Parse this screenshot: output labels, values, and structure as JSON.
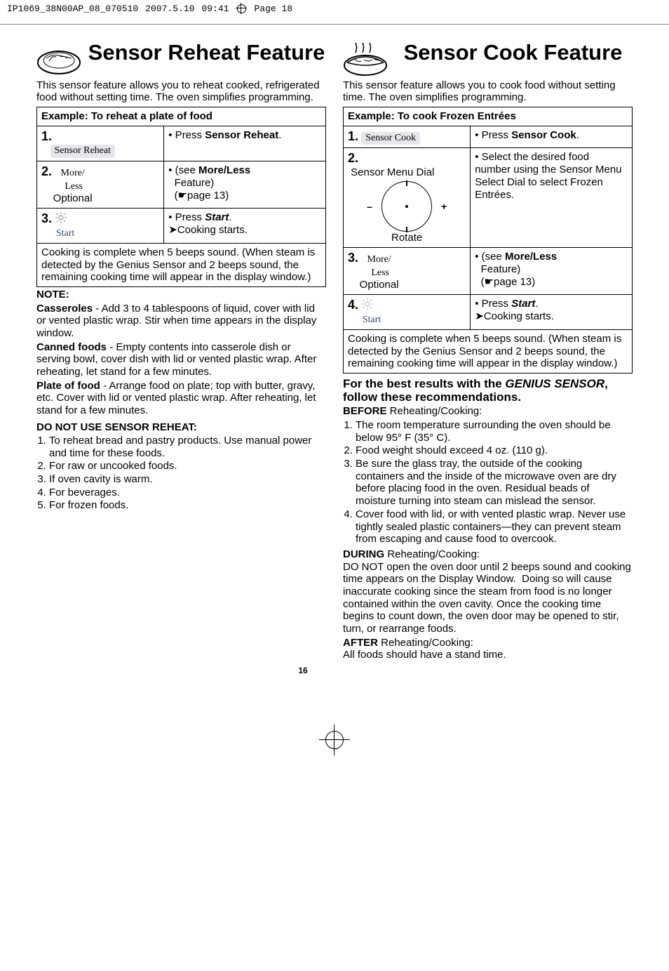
{
  "topbar": {
    "job": "IP1069_38N00AP_08_070510",
    "date": "2007.5.10",
    "time": "09:41",
    "page": "Page 18"
  },
  "left": {
    "title": "Sensor Reheat Feature",
    "intro": "This sensor feature allows you to reheat cooked, refrigerated food without setting time. The oven simplifies programming.",
    "exampleTitle": "Example: To reheat a plate of food",
    "step1": {
      "n": "1.",
      "btn": "Sensor Reheat",
      "r": "• Press Sensor Reheat."
    },
    "step2": {
      "n": "2.",
      "more": "More/",
      "less": "Less",
      "opt": "Optional",
      "r1": "• (see More/Less",
      "r2": "   Feature)",
      "r3": "   (☛page 13)"
    },
    "step3": {
      "n": "3.",
      "start": "Start",
      "r1": "• Press Start.",
      "r2": "➤Cooking starts."
    },
    "cookNote": "Cooking is complete when 5 beeps sound. (When steam is detected by the Genius Sensor and 2 beeps sound, the remaining cooking time will appear in the display window.)",
    "noteTitle": "NOTE:",
    "cassTitle": "Casseroles",
    "cassBody": " - Add 3 to 4 tablespoons of liquid, cover with lid or vented plastic wrap. Stir when time appears in the display window.",
    "cannedTitle": "Canned foods",
    "cannedBody": " - Empty contents into casserole dish or serving bowl, cover dish with lid or vented plastic wrap. After reheating, let stand for a few minutes.",
    "plateTitle": "Plate of food",
    "plateBody": " - Arrange food on plate; top with butter, gravy, etc. Cover with lid or vented plastic wrap. After reheating, let stand for a few minutes.",
    "dontTitle": "DO NOT USE SENSOR REHEAT:",
    "dont": [
      "To reheat bread and pastry products. Use manual power and time for these foods.",
      "For raw or uncooked foods.",
      "If oven cavity is warm.",
      "For beverages.",
      "For frozen foods."
    ]
  },
  "right": {
    "title": "Sensor Cook Feature",
    "intro": "This sensor feature allows you to cook food without setting time. The oven simplifies programming.",
    "exampleTitle": "Example: To cook Frozen Entrées",
    "step1": {
      "n": "1.",
      "btn": "Sensor Cook",
      "r": "• Press Sensor Cook."
    },
    "step2": {
      "n": "2.",
      "dial": "Sensor Menu Dial",
      "rotate": "Rotate",
      "r": "• Select the desired food number using the Sensor Menu Select Dial to select Frozen Entrées."
    },
    "step3": {
      "n": "3.",
      "more": "More/",
      "less": "Less",
      "opt": "Optional",
      "r1": "• (see More/Less",
      "r2": "   Feature)",
      "r3": "   (☛page 13)"
    },
    "step4": {
      "n": "4.",
      "start": "Start",
      "r1": "• Press Start.",
      "r2": "➤Cooking starts."
    },
    "cookNote": "Cooking is complete when 5 beeps sound. (When steam is detected by the Genius Sensor and 2 beeps sound, the remaining cooking time will appear in the display window.)",
    "bestTitle": "For the best results with the GENIUS SENSOR, follow these recommendations.",
    "beforeTitle": "BEFORE",
    "beforeSub": " Reheating/Cooking:",
    "before": [
      "The room temperature surrounding the oven should be below 95° F (35° C).",
      "Food weight should exceed 4 oz. (110 g).",
      "Be sure the glass tray, the outside of the cooking containers and the inside of the microwave oven are dry before placing food in the oven. Residual beads of moisture turning into steam can mislead the sensor.",
      "Cover food with lid, or with vented plastic wrap. Never use tightly sealed plastic containers—they can prevent steam from escaping and cause food to overcook."
    ],
    "duringTitle": "DURING",
    "duringBody": " Reheating/Cooking:\nDO NOT open the oven door until 2 beeps sound and cooking time appears on the Display Window.  Doing so will cause inaccurate cooking since the steam from food is no longer contained within the oven cavity. Once the cooking time begins to count down, the oven door may be opened to stir, turn, or rearrange foods.",
    "afterTitle": "AFTER",
    "afterBody": " Reheating/Cooking:\nAll foods should have a stand time."
  },
  "pageNum": "16"
}
